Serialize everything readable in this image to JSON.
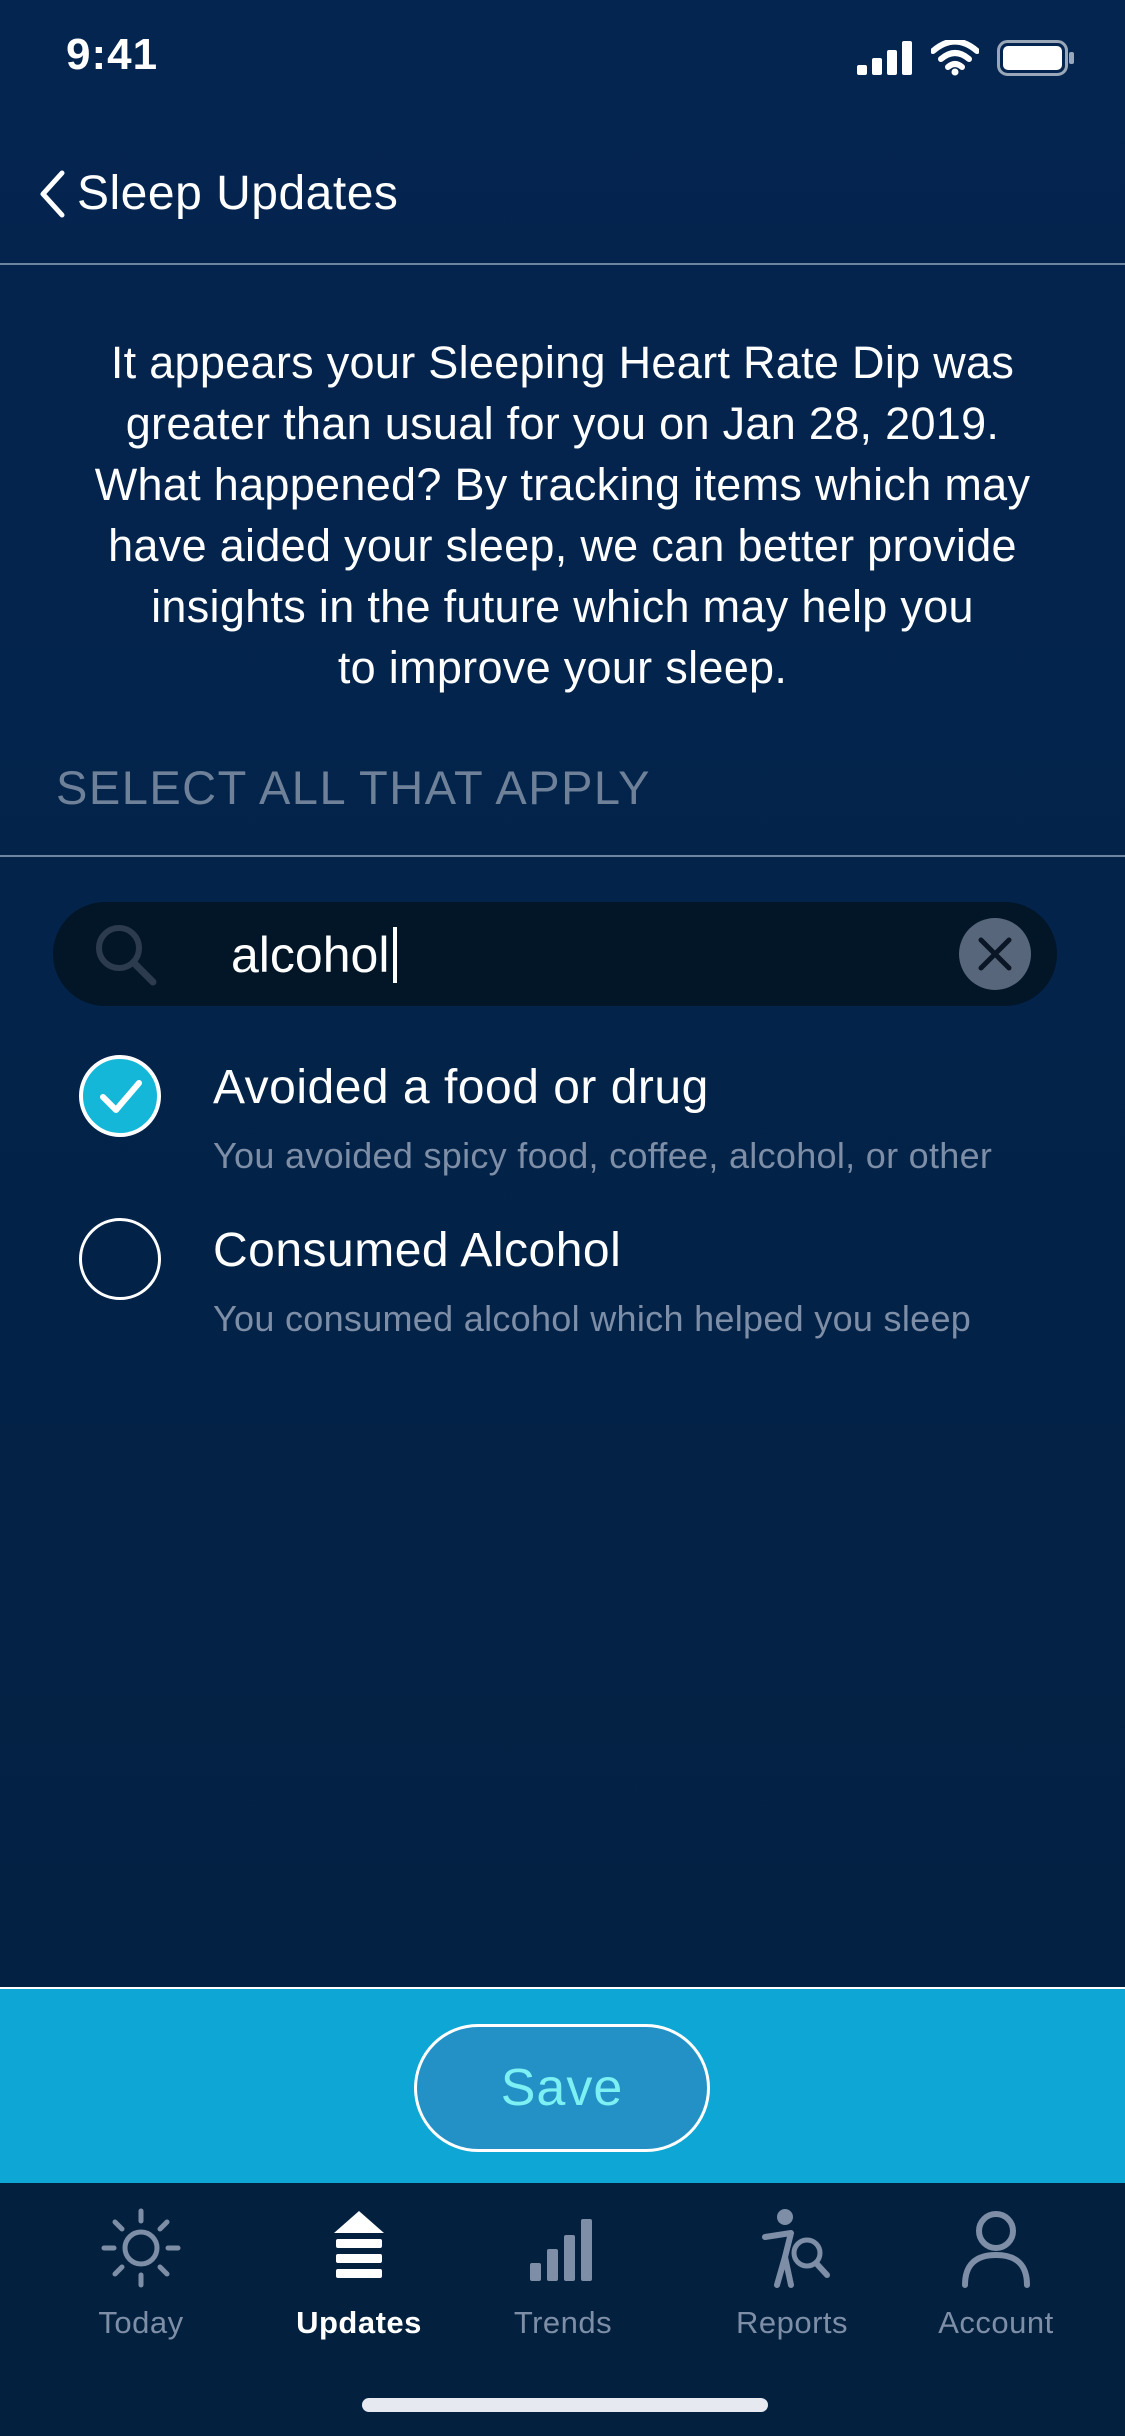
{
  "status_bar": {
    "time": "9:41"
  },
  "nav": {
    "title": "Sleep Updates"
  },
  "intro": {
    "lines": [
      "It appears your Sleeping Heart Rate Dip was",
      "greater than usual for you on Jan 28, 2019.",
      "What happened? By tracking items which may",
      "have aided your sleep, we can better provide",
      "insights in the future which may help you",
      "to improve your sleep."
    ]
  },
  "section_label": "SELECT ALL THAT APPLY",
  "search": {
    "value": "alcohol"
  },
  "options": [
    {
      "title": "Avoided a food or drug",
      "subtitle": "You avoided spicy food, coffee, alcohol, or other",
      "checked": true
    },
    {
      "title": "Consumed Alcohol",
      "subtitle": "You consumed alcohol which helped you sleep",
      "checked": false
    }
  ],
  "save": {
    "label": "Save"
  },
  "tabs": [
    {
      "label": "Today",
      "icon": "sun-icon",
      "active": false
    },
    {
      "label": "Updates",
      "icon": "updates-icon",
      "active": true
    },
    {
      "label": "Trends",
      "icon": "bar-chart-icon",
      "active": false
    },
    {
      "label": "Reports",
      "icon": "reports-icon",
      "active": false
    },
    {
      "label": "Account",
      "icon": "person-icon",
      "active": false
    }
  ],
  "colors": {
    "background": "#042550",
    "accent": "#14b7d8",
    "save_bar": "#0ea6d4",
    "save_text": "#7cf0f2",
    "muted_text": "#7d8ea6"
  }
}
